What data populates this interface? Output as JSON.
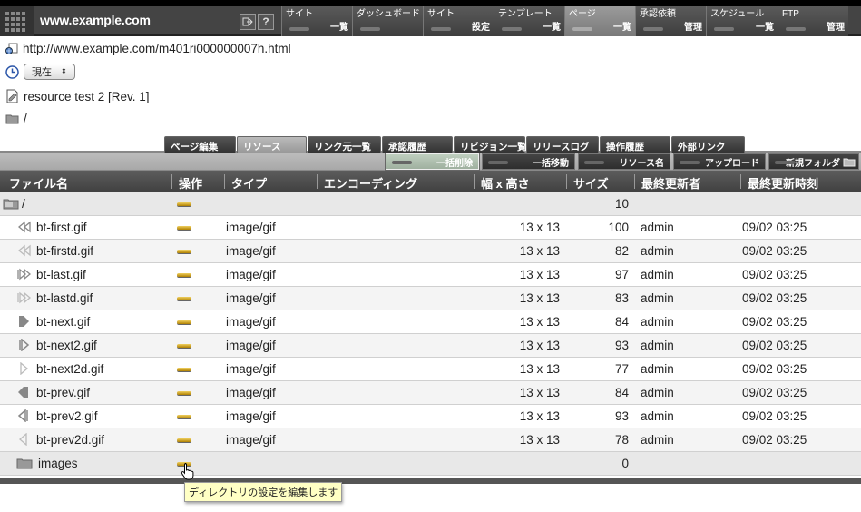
{
  "site": {
    "name": "www.example.com"
  },
  "global_nav": [
    {
      "top": "サイト",
      "bottom": "一覧",
      "active": false,
      "width": 78
    },
    {
      "top": "ダッシュボード",
      "bottom": "",
      "active": false,
      "width": 78
    },
    {
      "top": "サイト",
      "bottom": "設定",
      "active": false,
      "width": 78
    },
    {
      "top": "テンプレート",
      "bottom": "一覧",
      "active": false,
      "width": 78
    },
    {
      "top": "ページ",
      "bottom": "一覧",
      "active": true,
      "width": 78
    },
    {
      "top": "承認依頼",
      "bottom": "管理",
      "active": false,
      "width": 78
    },
    {
      "top": "スケジュール",
      "bottom": "一覧",
      "active": false,
      "width": 79
    },
    {
      "top": "FTP",
      "bottom": "管理",
      "active": false,
      "width": 78
    }
  ],
  "page_info": {
    "url": "http://www.example.com/m401ri000000007h.html",
    "version": "現在",
    "resource_name": "resource test 2 [Rev. 1]",
    "folder_path": "/"
  },
  "tabs": [
    "ページ編集",
    "リソース",
    "リンク元一覧",
    "承認履歴",
    "リビジョン一覧",
    "リリースログ",
    "操作履歴",
    "外部リンク"
  ],
  "active_tab": "リソース",
  "actions": [
    "一括削除",
    "一括移動",
    "リソース名",
    "アップロード",
    "新規フォルダ"
  ],
  "table": {
    "headers": [
      "ファイル名",
      "操作",
      "タイプ",
      "エンコーディング",
      "幅 x 高さ",
      "サイズ",
      "最終更新者",
      "最終更新時刻"
    ],
    "rows": [
      {
        "name": "/",
        "type": "",
        "dims": "",
        "size": "10",
        "updater": "",
        "time": "",
        "icon": "folder-up-icon",
        "kind": "dir"
      },
      {
        "name": "bt-first.gif",
        "type": "image/gif",
        "dims": "13 x 13",
        "size": "100",
        "updater": "admin",
        "time": "09/02 03:25",
        "icon": "first-arrow-icon",
        "kind": "file"
      },
      {
        "name": "bt-firstd.gif",
        "type": "image/gif",
        "dims": "13 x 13",
        "size": "82",
        "updater": "admin",
        "time": "09/02 03:25",
        "icon": "first-arrow-disabled-icon",
        "kind": "file"
      },
      {
        "name": "bt-last.gif",
        "type": "image/gif",
        "dims": "13 x 13",
        "size": "97",
        "updater": "admin",
        "time": "09/02 03:25",
        "icon": "last-arrow-icon",
        "kind": "file"
      },
      {
        "name": "bt-lastd.gif",
        "type": "image/gif",
        "dims": "13 x 13",
        "size": "83",
        "updater": "admin",
        "time": "09/02 03:25",
        "icon": "last-arrow-disabled-icon",
        "kind": "file"
      },
      {
        "name": "bt-next.gif",
        "type": "image/gif",
        "dims": "13 x 13",
        "size": "84",
        "updater": "admin",
        "time": "09/02 03:25",
        "icon": "next-arrow-icon",
        "kind": "file"
      },
      {
        "name": "bt-next2.gif",
        "type": "image/gif",
        "dims": "13 x 13",
        "size": "93",
        "updater": "admin",
        "time": "09/02 03:25",
        "icon": "next-arrow-alt-icon",
        "kind": "file"
      },
      {
        "name": "bt-next2d.gif",
        "type": "image/gif",
        "dims": "13 x 13",
        "size": "77",
        "updater": "admin",
        "time": "09/02 03:25",
        "icon": "next-arrow-disabled-icon",
        "kind": "file"
      },
      {
        "name": "bt-prev.gif",
        "type": "image/gif",
        "dims": "13 x 13",
        "size": "84",
        "updater": "admin",
        "time": "09/02 03:25",
        "icon": "prev-arrow-icon",
        "kind": "file"
      },
      {
        "name": "bt-prev2.gif",
        "type": "image/gif",
        "dims": "13 x 13",
        "size": "93",
        "updater": "admin",
        "time": "09/02 03:25",
        "icon": "prev-arrow-alt-icon",
        "kind": "file"
      },
      {
        "name": "bt-prev2d.gif",
        "type": "image/gif",
        "dims": "13 x 13",
        "size": "78",
        "updater": "admin",
        "time": "09/02 03:25",
        "icon": "prev-arrow-disabled-icon",
        "kind": "file"
      },
      {
        "name": "images",
        "type": "",
        "dims": "",
        "size": "0",
        "updater": "",
        "time": "",
        "icon": "folder-icon",
        "kind": "dir"
      }
    ]
  },
  "tooltip": "ディレクトリの設定を編集します"
}
